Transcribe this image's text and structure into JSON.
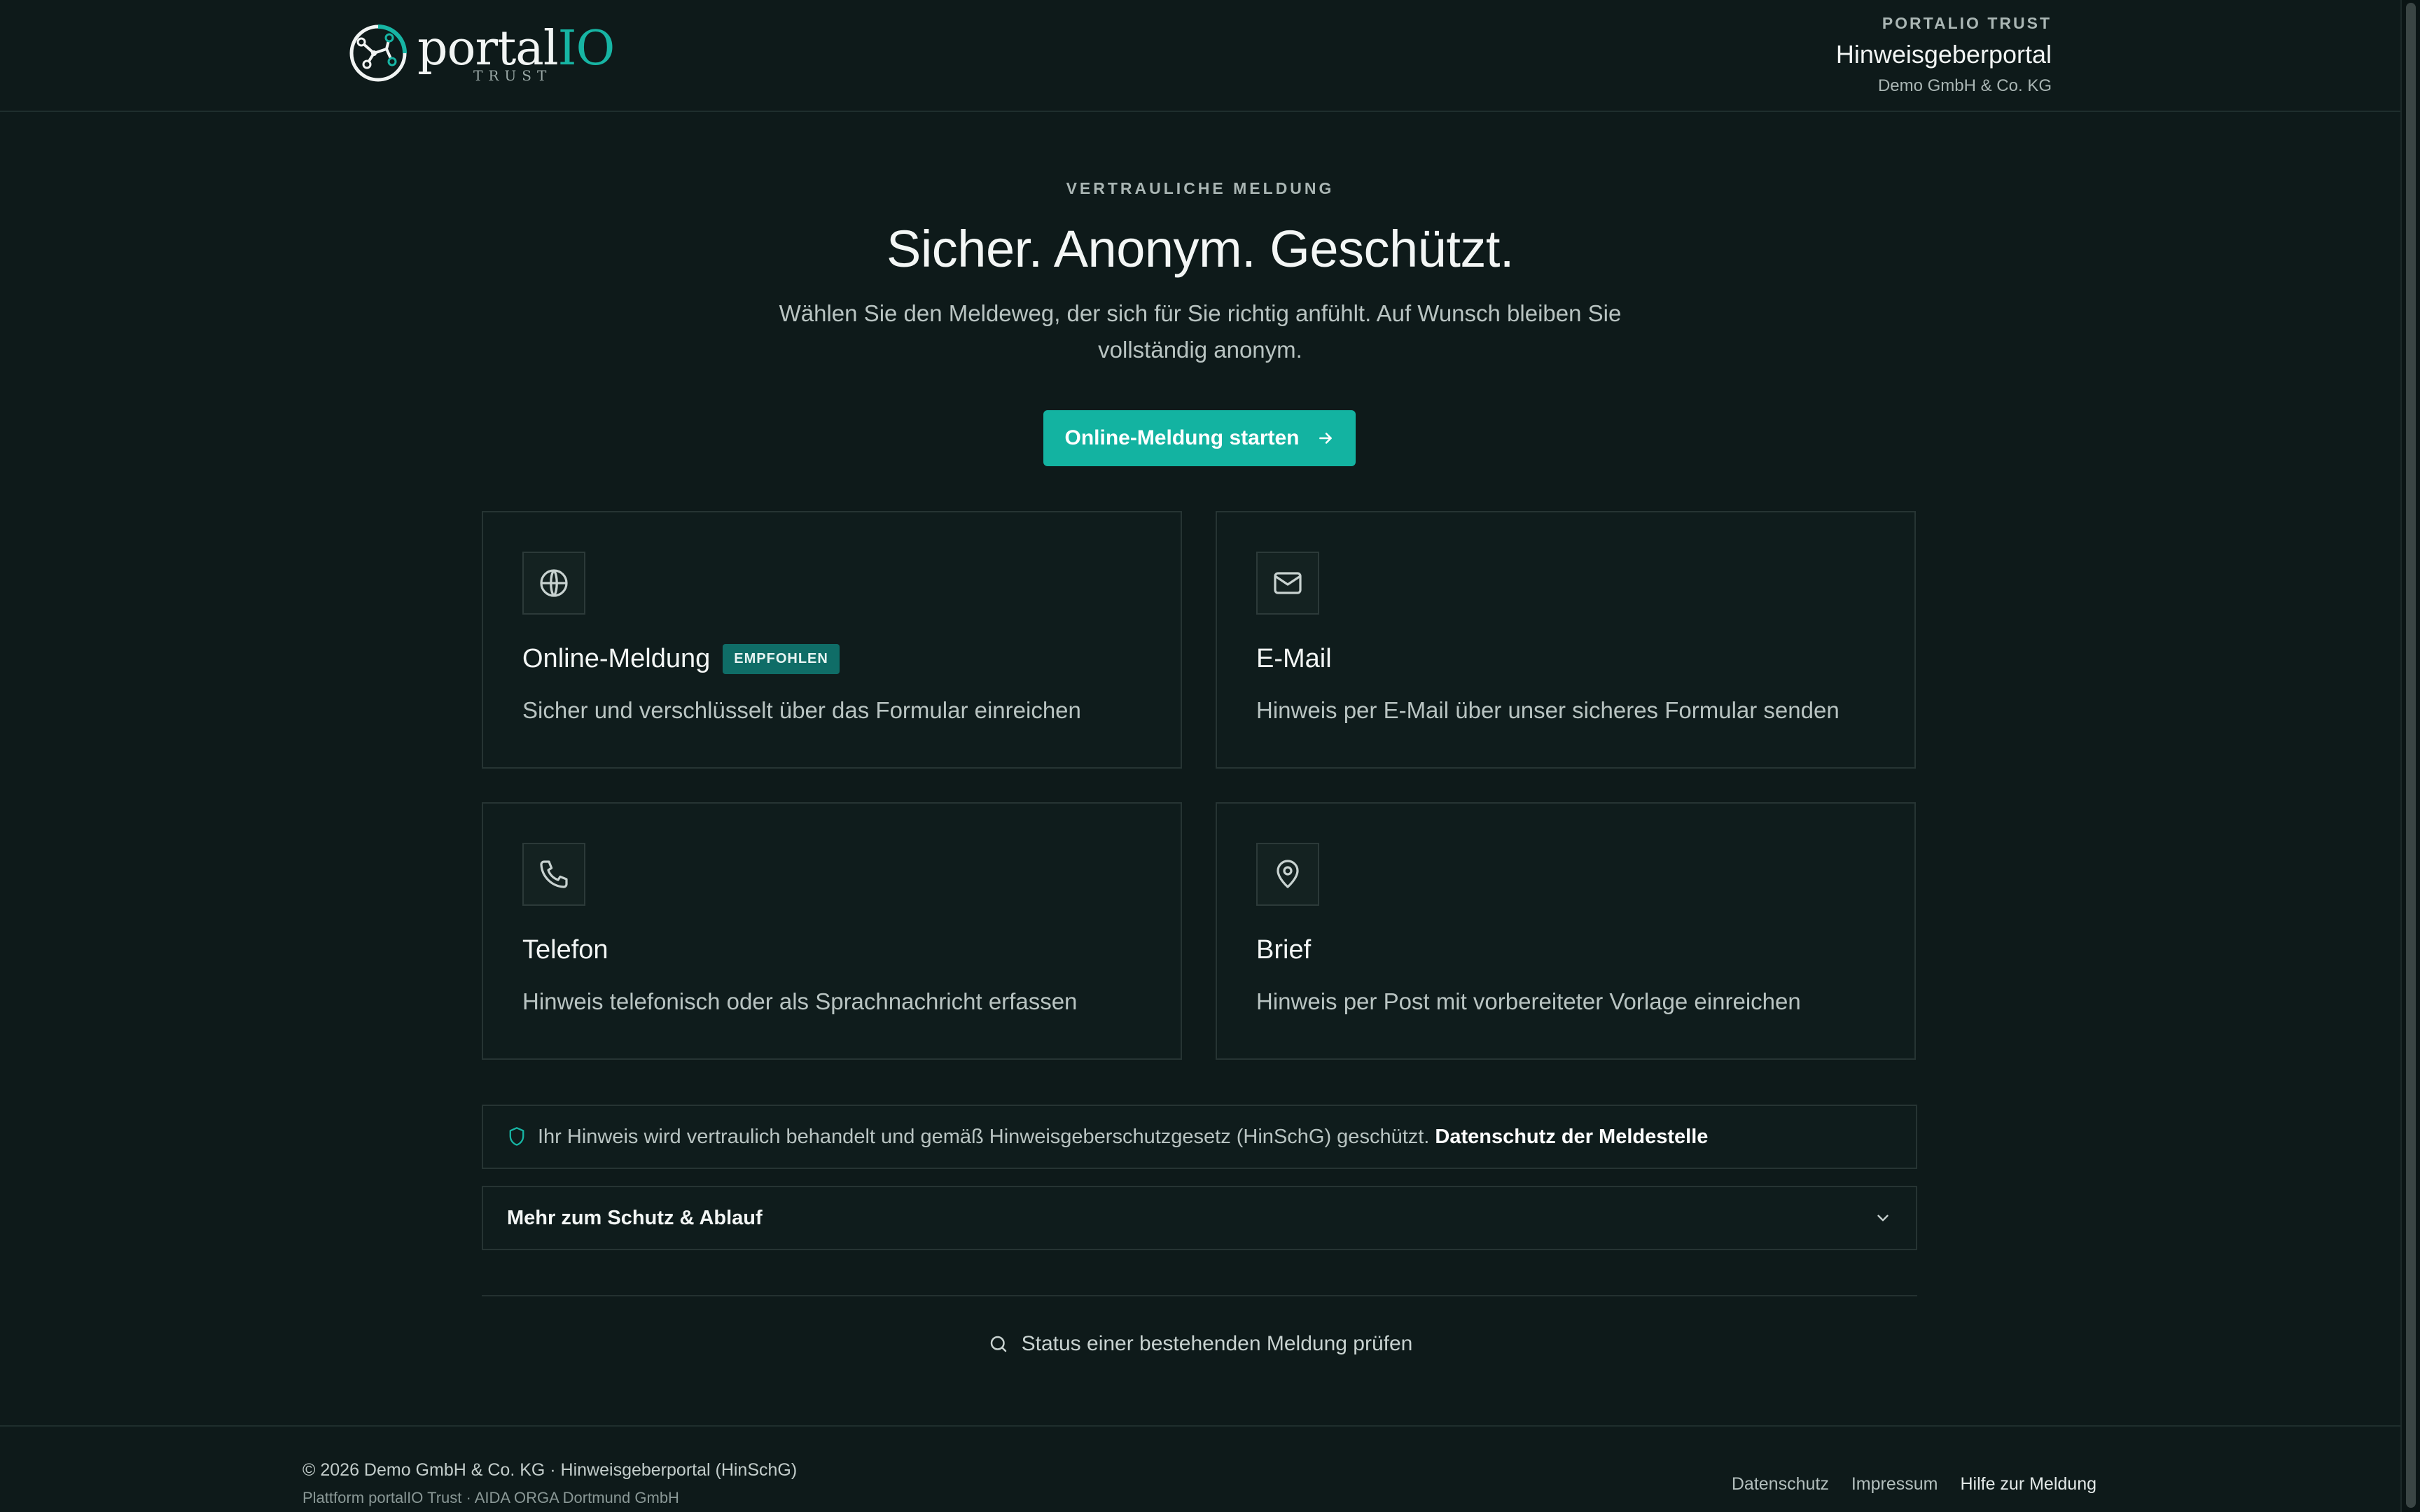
{
  "header": {
    "logo_word": "portal",
    "logo_io": "IO",
    "logo_sub": "TRUST",
    "kicker": "PORTALIO TRUST",
    "title": "Hinweisgeberportal",
    "company": "Demo GmbH & Co. KG"
  },
  "hero": {
    "kicker": "VERTRAULICHE MELDUNG",
    "title": "Sicher. Anonym. Geschützt.",
    "subtitle": "Wählen Sie den Meldeweg, der sich für Sie richtig anfühlt. Auf Wunsch bleiben Sie vollständig anonym.",
    "cta_label": "Online-Meldung starten"
  },
  "cards": [
    {
      "title": "Online-Meldung",
      "badge": "EMPFOHLEN",
      "desc": "Sicher und verschlüsselt über das Formular einreichen",
      "icon": "globe-icon"
    },
    {
      "title": "E-Mail",
      "desc": "Hinweis per E-Mail über unser sicheres Formular senden",
      "icon": "mail-icon"
    },
    {
      "title": "Telefon",
      "desc": "Hinweis telefonisch oder als Sprachnachricht erfassen",
      "icon": "phone-icon"
    },
    {
      "title": "Brief",
      "desc": "Hinweis per Post mit vorbereiteter Vorlage einreichen",
      "icon": "map-pin-icon"
    }
  ],
  "info": {
    "text": "Ihr Hinweis wird vertraulich behandelt und gemäß Hinweisgeberschutzgesetz (HinSchG) geschützt.",
    "link": "Datenschutz der Meldestelle"
  },
  "accordion": {
    "label": "Mehr zum Schutz & Ablauf"
  },
  "status_link": "Status einer bestehenden Meldung prüfen",
  "footer": {
    "copyright": "© 2026 Demo GmbH & Co. KG · Hinweisgeberportal (HinSchG)",
    "platform": "Plattform portalIO Trust · AIDA ORGA Dortmund GmbH",
    "links": [
      "Datenschutz",
      "Impressum",
      "Hilfe zur Meldung"
    ]
  },
  "colors": {
    "background": "#0e1a1a",
    "accent": "#13b3a1",
    "badge": "#0f6d67"
  }
}
